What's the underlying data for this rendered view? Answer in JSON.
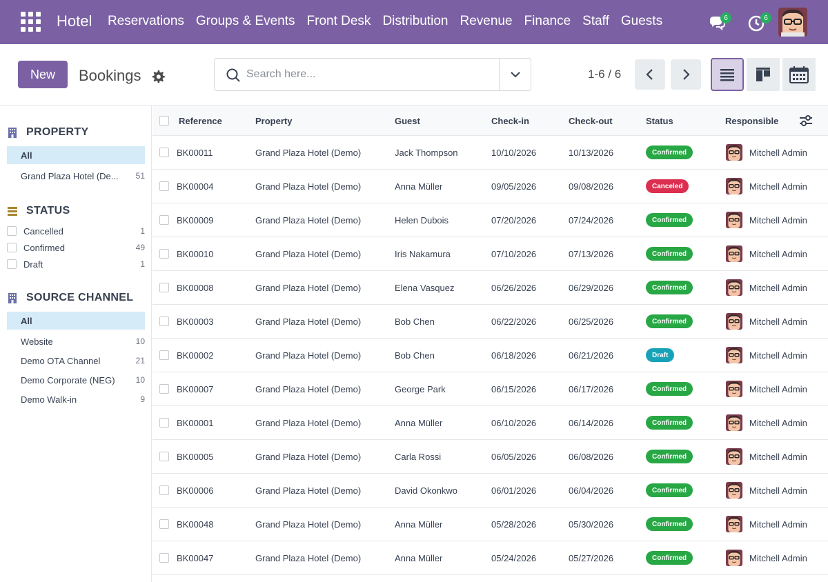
{
  "topbar": {
    "app_name": "Hotel",
    "nav": [
      "Reservations",
      "Groups & Events",
      "Front Desk",
      "Distribution",
      "Revenue",
      "Finance",
      "Staff",
      "Guests"
    ],
    "messages_badge": "6",
    "activities_badge": "6",
    "icons": [
      "apps-grid-icon",
      "chat-icon",
      "clock-icon",
      "avatar"
    ]
  },
  "control": {
    "new_label": "New",
    "title": "Bookings",
    "search_placeholder": "Search here...",
    "pager": "1-6 / 6",
    "views": [
      "list-view",
      "kanban-view",
      "calendar-view"
    ]
  },
  "sidebar": {
    "property": {
      "title": "PROPERTY",
      "items": [
        {
          "label": "All",
          "count": ""
        },
        {
          "label": "Grand Plaza Hotel (De...",
          "count": "51"
        }
      ]
    },
    "status": {
      "title": "STATUS",
      "items": [
        {
          "label": "Cancelled",
          "count": "1"
        },
        {
          "label": "Confirmed",
          "count": "49"
        },
        {
          "label": "Draft",
          "count": "1"
        }
      ]
    },
    "source": {
      "title": "SOURCE CHANNEL",
      "items": [
        {
          "label": "All",
          "count": ""
        },
        {
          "label": "Website",
          "count": "10"
        },
        {
          "label": "Demo OTA Channel",
          "count": "21"
        },
        {
          "label": "Demo Corporate (NEG)",
          "count": "10"
        },
        {
          "label": "Demo Walk-in",
          "count": "9"
        }
      ]
    }
  },
  "table": {
    "headers": [
      "Reference",
      "Property",
      "Guest",
      "Check-in",
      "Check-out",
      "Status",
      "Responsible"
    ],
    "rows": [
      [
        "BK00011",
        "Grand Plaza Hotel (Demo)",
        "Jack Thompson",
        "10/10/2026",
        "10/13/2026",
        "Confirmed",
        "Mitchell Admin"
      ],
      [
        "BK00004",
        "Grand Plaza Hotel (Demo)",
        "Anna Müller",
        "09/05/2026",
        "09/08/2026",
        "Canceled",
        "Mitchell Admin"
      ],
      [
        "BK00009",
        "Grand Plaza Hotel (Demo)",
        "Helen Dubois",
        "07/20/2026",
        "07/24/2026",
        "Confirmed",
        "Mitchell Admin"
      ],
      [
        "BK00010",
        "Grand Plaza Hotel (Demo)",
        "Iris Nakamura",
        "07/10/2026",
        "07/13/2026",
        "Confirmed",
        "Mitchell Admin"
      ],
      [
        "BK00008",
        "Grand Plaza Hotel (Demo)",
        "Elena Vasquez",
        "06/26/2026",
        "06/29/2026",
        "Confirmed",
        "Mitchell Admin"
      ],
      [
        "BK00003",
        "Grand Plaza Hotel (Demo)",
        "Bob Chen",
        "06/22/2026",
        "06/25/2026",
        "Confirmed",
        "Mitchell Admin"
      ],
      [
        "BK00002",
        "Grand Plaza Hotel (Demo)",
        "Bob Chen",
        "06/18/2026",
        "06/21/2026",
        "Draft",
        "Mitchell Admin"
      ],
      [
        "BK00007",
        "Grand Plaza Hotel (Demo)",
        "George Park",
        "06/15/2026",
        "06/17/2026",
        "Confirmed",
        "Mitchell Admin"
      ],
      [
        "BK00001",
        "Grand Plaza Hotel (Demo)",
        "Anna Müller",
        "06/10/2026",
        "06/14/2026",
        "Confirmed",
        "Mitchell Admin"
      ],
      [
        "BK00005",
        "Grand Plaza Hotel (Demo)",
        "Carla Rossi",
        "06/05/2026",
        "06/08/2026",
        "Confirmed",
        "Mitchell Admin"
      ],
      [
        "BK00006",
        "Grand Plaza Hotel (Demo)",
        "David Okonkwo",
        "06/01/2026",
        "06/04/2026",
        "Confirmed",
        "Mitchell Admin"
      ],
      [
        "BK00048",
        "Grand Plaza Hotel (Demo)",
        "Anna Müller",
        "05/28/2026",
        "05/30/2026",
        "Confirmed",
        "Mitchell Admin"
      ],
      [
        "BK00047",
        "Grand Plaza Hotel (Demo)",
        "Anna Müller",
        "05/24/2026",
        "05/27/2026",
        "Confirmed",
        "Mitchell Admin"
      ]
    ]
  },
  "colors": {
    "brand": "#7b61a3",
    "confirmed": "#28a745",
    "canceled": "#dc2f4f",
    "draft": "#17a2b8",
    "selected_facet": "#d5ebf7"
  }
}
